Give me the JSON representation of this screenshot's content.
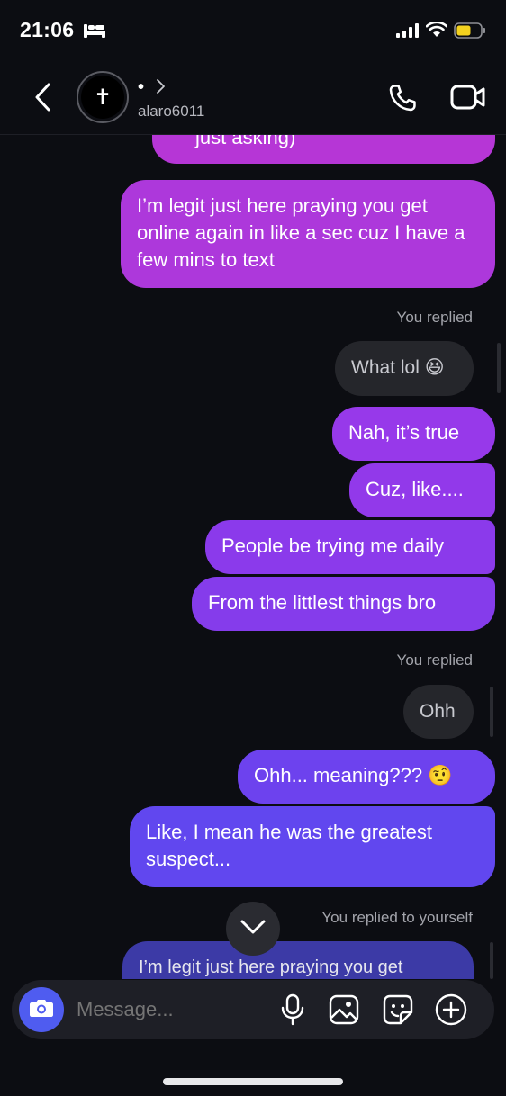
{
  "status_bar": {
    "time": "21:06"
  },
  "header": {
    "name": "•",
    "username": "alaro6011",
    "avatar_symbol": "✝"
  },
  "messages": {
    "m0": "just asking)",
    "m1": "I’m legit just here praying you get online again in like a sec cuz I have a few mins to text",
    "meta1": "You replied",
    "reply1": "What lol 😆",
    "m2": "Nah, it’s true",
    "m3": "Cuz, like....",
    "m4": "People be trying me daily",
    "m5": "From the littlest things bro",
    "meta2": "You replied",
    "reply2": "Ohh",
    "m6": "Ohh... meaning??? 🤨",
    "m7": "Like, I mean he was the greatest suspect...",
    "meta3": "You replied to yourself",
    "reply3": "I’m legit just here praying you get"
  },
  "composer": {
    "placeholder": "Message..."
  },
  "colors": {
    "accent": "#4f5cf0",
    "bubble_top": "#b03bd6",
    "bubble_bottom": "#5a4ef0"
  }
}
